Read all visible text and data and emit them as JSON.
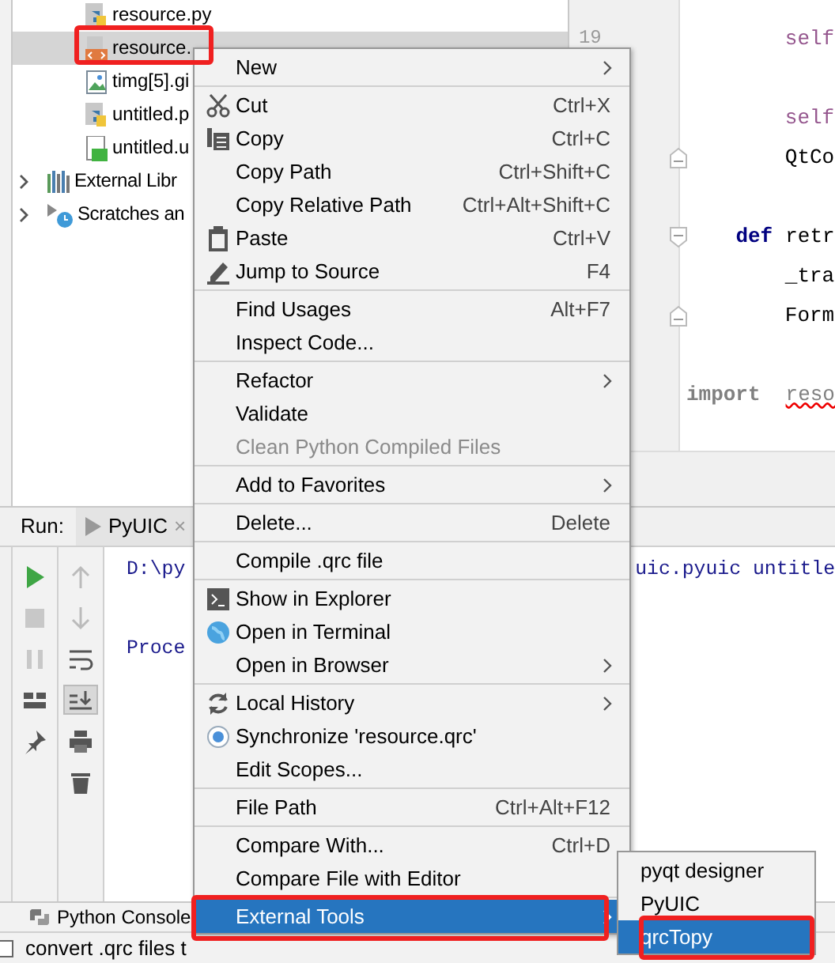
{
  "project_tree": {
    "files": [
      {
        "label": "resource.py",
        "kind": "python",
        "selected": false,
        "highlighted": false
      },
      {
        "label": "resource.",
        "kind": "qrc",
        "selected": true,
        "highlighted": true
      },
      {
        "label": "timg[5].gi",
        "kind": "image",
        "selected": false,
        "highlighted": false
      },
      {
        "label": "untitled.p",
        "kind": "python",
        "selected": false,
        "highlighted": false
      },
      {
        "label": "untitled.u",
        "kind": "ui",
        "selected": false,
        "highlighted": false
      }
    ],
    "roots": [
      {
        "label": "External Libr",
        "kind": "library",
        "expanded": false
      },
      {
        "label": "Scratches an",
        "kind": "scratches",
        "expanded": false
      }
    ]
  },
  "editor": {
    "lines": [
      {
        "kind": "plain"
      },
      {
        "kind": "plain",
        "number": "19",
        "segments": [
          {
            "kind": "self",
            "text": "        self"
          }
        ]
      },
      {
        "kind": "plain"
      },
      {
        "kind": "plain",
        "segments": [
          {
            "kind": "self",
            "text": "        self"
          }
        ]
      },
      {
        "kind": "foldend",
        "segments": [
          {
            "kind": "plain",
            "text": "        QtCo"
          }
        ]
      },
      {
        "kind": "plain"
      },
      {
        "kind": "foldstart",
        "segments": [
          {
            "kind": "keyword",
            "text": "    def"
          },
          {
            "kind": "plain",
            "text": "retr"
          }
        ]
      },
      {
        "kind": "plain",
        "segments": [
          {
            "kind": "plain",
            "text": "        _tra"
          }
        ]
      },
      {
        "kind": "foldend",
        "segments": [
          {
            "kind": "plain",
            "text": "        Form"
          }
        ]
      },
      {
        "kind": "plain"
      },
      {
        "kind": "plain",
        "segments": [
          {
            "kind": "unused",
            "text": "import"
          },
          {
            "kind": "error",
            "text": "reso"
          }
        ]
      }
    ]
  },
  "run_panel": {
    "label": "Run:",
    "tab": {
      "label": "PyUIC",
      "close": "×"
    },
    "console": [
      {
        "kind": "text",
        "segments": [
          "D:\\py",
          "uic.pyuic untitle"
        ]
      },
      {
        "kind": "blank"
      },
      {
        "kind": "text",
        "segments": [
          "Proce"
        ]
      }
    ]
  },
  "bottom_tabs": [
    {
      "label": "Python Console"
    }
  ],
  "status_bar": {
    "text": "convert .qrc files t"
  },
  "context_menu": {
    "items": [
      {
        "kind": "item",
        "label": "New",
        "submenu": true,
        "disabled": false,
        "selected": false,
        "highlighted": false
      },
      {
        "kind": "separator"
      },
      {
        "kind": "item",
        "label": "Cut",
        "shortcut": "Ctrl+X",
        "submenu": false,
        "disabled": false,
        "selected": false,
        "highlighted": false
      },
      {
        "kind": "item",
        "label": "Copy",
        "shortcut": "Ctrl+C",
        "submenu": false,
        "disabled": false,
        "selected": false,
        "highlighted": false
      },
      {
        "kind": "item",
        "label": "Copy Path",
        "shortcut": "Ctrl+Shift+C",
        "submenu": false,
        "disabled": false,
        "selected": false,
        "highlighted": false
      },
      {
        "kind": "item",
        "label": "Copy Relative Path",
        "shortcut": "Ctrl+Alt+Shift+C",
        "submenu": false,
        "disabled": false,
        "selected": false,
        "highlighted": false
      },
      {
        "kind": "item",
        "label": "Paste",
        "shortcut": "Ctrl+V",
        "submenu": false,
        "disabled": false,
        "selected": false,
        "highlighted": false
      },
      {
        "kind": "item",
        "label": "Jump to Source",
        "shortcut": "F4",
        "submenu": false,
        "disabled": false,
        "selected": false,
        "highlighted": false
      },
      {
        "kind": "separator"
      },
      {
        "kind": "item",
        "label": "Find Usages",
        "shortcut": "Alt+F7",
        "submenu": false,
        "disabled": false,
        "selected": false,
        "highlighted": false
      },
      {
        "kind": "item",
        "label": "Inspect Code...",
        "submenu": false,
        "disabled": false,
        "selected": false,
        "highlighted": false
      },
      {
        "kind": "separator"
      },
      {
        "kind": "item",
        "label": "Refactor",
        "submenu": true,
        "disabled": false,
        "selected": false,
        "highlighted": false
      },
      {
        "kind": "item",
        "label": "Validate",
        "submenu": false,
        "disabled": false,
        "selected": false,
        "highlighted": false
      },
      {
        "kind": "item",
        "label": "Clean Python Compiled Files",
        "submenu": false,
        "disabled": true,
        "selected": false,
        "highlighted": false
      },
      {
        "kind": "separator"
      },
      {
        "kind": "item",
        "label": "Add to Favorites",
        "submenu": true,
        "disabled": false,
        "selected": false,
        "highlighted": false
      },
      {
        "kind": "separator"
      },
      {
        "kind": "item",
        "label": "Delete...",
        "shortcut": "Delete",
        "submenu": false,
        "disabled": false,
        "selected": false,
        "highlighted": false
      },
      {
        "kind": "separator"
      },
      {
        "kind": "item",
        "label": "Compile .qrc file",
        "submenu": false,
        "disabled": false,
        "selected": false,
        "highlighted": false
      },
      {
        "kind": "separator"
      },
      {
        "kind": "item",
        "label": "Show in Explorer",
        "submenu": false,
        "disabled": false,
        "selected": false,
        "highlighted": false
      },
      {
        "kind": "item",
        "label": "Open in Terminal",
        "submenu": false,
        "disabled": false,
        "selected": false,
        "highlighted": false
      },
      {
        "kind": "item",
        "label": "Open in Browser",
        "submenu": true,
        "disabled": false,
        "selected": false,
        "highlighted": false
      },
      {
        "kind": "separator"
      },
      {
        "kind": "item",
        "label": "Local History",
        "submenu": true,
        "disabled": false,
        "selected": false,
        "highlighted": false
      },
      {
        "kind": "item",
        "label": "Synchronize 'resource.qrc'",
        "submenu": false,
        "disabled": false,
        "selected": false,
        "highlighted": false
      },
      {
        "kind": "item",
        "label": "Edit Scopes...",
        "submenu": false,
        "disabled": false,
        "selected": false,
        "highlighted": false
      },
      {
        "kind": "separator"
      },
      {
        "kind": "item",
        "label": "File Path",
        "shortcut": "Ctrl+Alt+F12",
        "submenu": false,
        "disabled": false,
        "selected": false,
        "highlighted": false
      },
      {
        "kind": "separator"
      },
      {
        "kind": "item",
        "label": "Compare With...",
        "shortcut": "Ctrl+D",
        "submenu": false,
        "disabled": false,
        "selected": false,
        "highlighted": false
      },
      {
        "kind": "item",
        "label": "Compare File with Editor",
        "submenu": false,
        "disabled": false,
        "selected": false,
        "highlighted": false
      },
      {
        "kind": "separator"
      },
      {
        "kind": "item",
        "label": "External Tools",
        "submenu": true,
        "disabled": false,
        "selected": true,
        "highlighted": true
      }
    ]
  },
  "submenu": {
    "items": [
      {
        "label": "pyqt designer",
        "selected": false,
        "highlighted": false
      },
      {
        "label": "PyUIC",
        "selected": false,
        "highlighted": false
      },
      {
        "label": "qrcTopy",
        "selected": true,
        "highlighted": true
      }
    ]
  }
}
